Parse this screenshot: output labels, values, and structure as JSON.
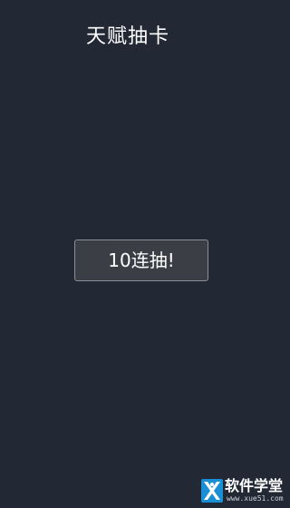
{
  "header": {
    "title": "天赋抽卡"
  },
  "main": {
    "draw_button_label": "10连抽!"
  },
  "watermark": {
    "brand": "软件学堂",
    "domain": "www.xue51.com"
  },
  "colors": {
    "background": "#232934",
    "button_background": "#3b3f45",
    "button_border": "#8a8f96",
    "text": "#ffffff",
    "logo_blue": "#1a8fd6"
  }
}
